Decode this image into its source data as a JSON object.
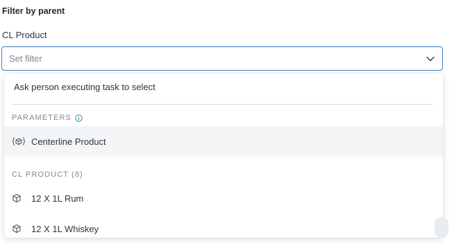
{
  "filter": {
    "section_title": "Filter by parent",
    "field_label": "CL Product",
    "select_placeholder": "Set filter"
  },
  "dropdown": {
    "ask_option": "Ask person executing task to select",
    "parameters_group": {
      "header": "PARAMETERS",
      "items": [
        {
          "label": "Centerline Product",
          "icon": "parameter-cube-icon",
          "highlighted": true
        }
      ]
    },
    "cl_product_group": {
      "header": "CL PRODUCT (8)",
      "items": [
        {
          "label": "12 X 1L Rum",
          "icon": "cube-icon"
        },
        {
          "label": "12 X 1L Whiskey",
          "icon": "cube-icon"
        }
      ]
    }
  },
  "colors": {
    "select_border": "#3a7bbf",
    "info_icon": "#2a8a9a",
    "highlight_bg": "#f4f5f7"
  }
}
